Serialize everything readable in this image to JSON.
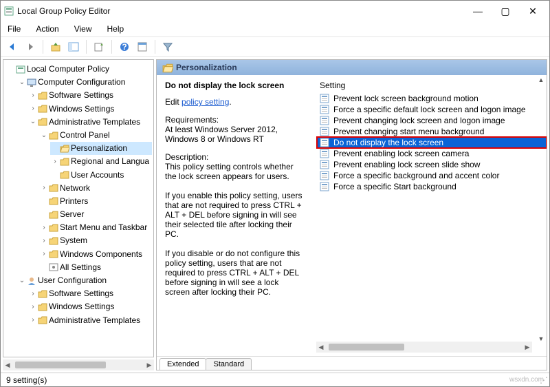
{
  "window": {
    "title": "Local Group Policy Editor",
    "min": "—",
    "max": "▢",
    "close": "✕"
  },
  "menu": {
    "file": "File",
    "action": "Action",
    "view": "View",
    "help": "Help"
  },
  "tree": {
    "root": "Local Computer Policy",
    "comp_config": "Computer Configuration",
    "sw_settings": "Software Settings",
    "win_settings": "Windows Settings",
    "admin_templates": "Administrative Templates",
    "control_panel": "Control Panel",
    "personalization": "Personalization",
    "regional": "Regional and Langua",
    "user_accounts": "User Accounts",
    "network": "Network",
    "printers": "Printers",
    "server": "Server",
    "start_menu": "Start Menu and Taskbar",
    "system": "System",
    "win_components": "Windows Components",
    "all_settings": "All Settings",
    "user_config": "User Configuration",
    "u_sw_settings": "Software Settings",
    "u_win_settings": "Windows Settings",
    "u_admin_templates": "Administrative Templates"
  },
  "details": {
    "header": "Personalization",
    "policy_title": "Do not display the lock screen",
    "edit_prefix": "Edit ",
    "edit_link": "policy setting",
    "req_label": "Requirements:",
    "req_text": "At least Windows Server 2012, Windows 8 or Windows RT",
    "desc_label": "Description:",
    "desc_p1": "This policy setting controls whether the lock screen appears for users.",
    "desc_p2": "If you enable this policy setting, users that are not required to press CTRL + ALT + DEL before signing in will see their selected tile after locking their PC.",
    "desc_p3": "If you disable or do not configure this policy setting, users that are not required to press CTRL + ALT + DEL before signing in will see a lock screen after locking their PC."
  },
  "settings_col": {
    "header": "Setting",
    "items": [
      "Prevent lock screen background motion",
      "Force a specific default lock screen and logon image",
      "Prevent changing lock screen and logon image",
      "Prevent changing start menu background",
      "Do not display the lock screen",
      "Prevent enabling lock screen camera",
      "Prevent enabling lock screen slide show",
      "Force a specific background and accent color",
      "Force a specific Start background"
    ]
  },
  "tabs": {
    "extended": "Extended",
    "standard": "Standard"
  },
  "status": {
    "count": "9 setting(s)"
  },
  "watermark": "wsxdn.com"
}
